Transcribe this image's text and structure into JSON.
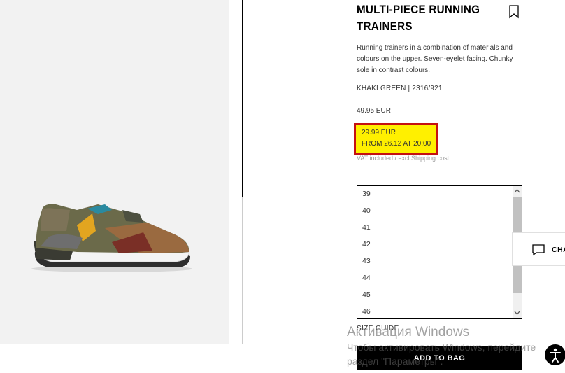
{
  "product": {
    "title": "MULTI-PIECE RUNNING TRAINERS",
    "description": "Running trainers in a combination of materials and colours on the upper. Seven-eyelet facing. Chunky sole in contrast colours.",
    "color_ref": "KHAKI GREEN | 2316/921",
    "old_price": "49.95 EUR",
    "promo_price": "29.99 EUR",
    "promo_date": "FROM 26.12 AT 20:00",
    "vat_note": "VAT included / excl Shipping cost"
  },
  "sizes": [
    "39",
    "40",
    "41",
    "42",
    "43",
    "44",
    "45",
    "46"
  ],
  "size_guide_label": "SIZE GUIDE",
  "add_to_bag_label": "ADD TO BAG",
  "chat_label": "CHA",
  "watermark": {
    "title": "Активация Windows",
    "line1": "Чтобы активировать Windows, перейдите",
    "line2": "раздел \"Параметры\"."
  },
  "colors": {
    "promo_bg": "#fff000",
    "promo_border": "#c41111",
    "button_bg": "#000000"
  },
  "icons": [
    "bookmark-icon",
    "chat-icon",
    "accessibility-icon",
    "scroll-up-icon",
    "scroll-down-icon"
  ]
}
